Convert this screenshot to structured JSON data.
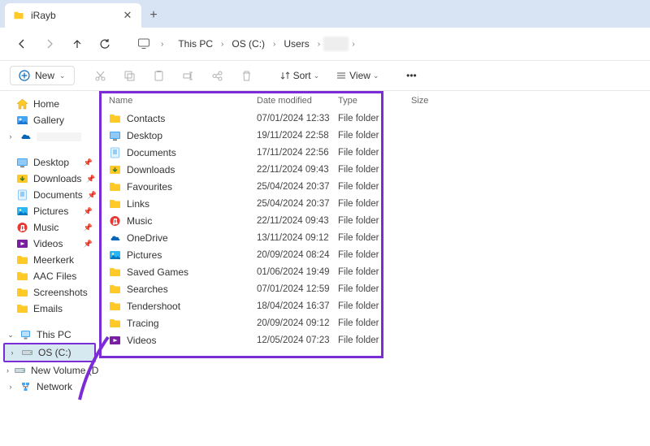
{
  "tab": {
    "title": "iRayb"
  },
  "breadcrumb": [
    "This PC",
    "OS (C:)",
    "Users"
  ],
  "toolbar": {
    "new_label": "New",
    "sort_label": "Sort",
    "view_label": "View"
  },
  "columns": {
    "name": "Name",
    "date": "Date modified",
    "type": "Type",
    "size": "Size"
  },
  "sidebar": {
    "quick": [
      {
        "label": "Home",
        "icon": "home"
      },
      {
        "label": "Gallery",
        "icon": "gallery"
      }
    ],
    "cloud_label": "",
    "pinned": [
      {
        "label": "Desktop",
        "icon": "desktop"
      },
      {
        "label": "Downloads",
        "icon": "downloads"
      },
      {
        "label": "Documents",
        "icon": "documents"
      },
      {
        "label": "Pictures",
        "icon": "pictures"
      },
      {
        "label": "Music",
        "icon": "music"
      },
      {
        "label": "Videos",
        "icon": "videos"
      },
      {
        "label": "Meerkerk",
        "icon": "folder"
      },
      {
        "label": "AAC Files",
        "icon": "folder"
      },
      {
        "label": "Screenshots",
        "icon": "folder"
      },
      {
        "label": "Emails",
        "icon": "folder"
      }
    ],
    "thispc": "This PC",
    "drives": [
      {
        "label": "OS (C:)",
        "selected": true
      },
      {
        "label": "New Volume (D:)",
        "selected": false
      }
    ],
    "network": "Network"
  },
  "files": [
    {
      "name": "Contacts",
      "date": "07/01/2024 12:33",
      "type": "File folder",
      "icon": "folder"
    },
    {
      "name": "Desktop",
      "date": "19/11/2024 22:58",
      "type": "File folder",
      "icon": "desktop"
    },
    {
      "name": "Documents",
      "date": "17/11/2024 22:56",
      "type": "File folder",
      "icon": "documents"
    },
    {
      "name": "Downloads",
      "date": "22/11/2024 09:43",
      "type": "File folder",
      "icon": "downloads"
    },
    {
      "name": "Favourites",
      "date": "25/04/2024 20:37",
      "type": "File folder",
      "icon": "folder"
    },
    {
      "name": "Links",
      "date": "25/04/2024 20:37",
      "type": "File folder",
      "icon": "folder"
    },
    {
      "name": "Music",
      "date": "22/11/2024 09:43",
      "type": "File folder",
      "icon": "music"
    },
    {
      "name": "OneDrive",
      "date": "13/11/2024 09:12",
      "type": "File folder",
      "icon": "onedrive"
    },
    {
      "name": "Pictures",
      "date": "20/09/2024 08:24",
      "type": "File folder",
      "icon": "pictures"
    },
    {
      "name": "Saved Games",
      "date": "01/06/2024 19:49",
      "type": "File folder",
      "icon": "folder"
    },
    {
      "name": "Searches",
      "date": "07/01/2024 12:59",
      "type": "File folder",
      "icon": "folder"
    },
    {
      "name": "Tendershoot",
      "date": "18/04/2024 16:37",
      "type": "File folder",
      "icon": "folder"
    },
    {
      "name": "Tracing",
      "date": "20/09/2024 09:12",
      "type": "File folder",
      "icon": "folder"
    },
    {
      "name": "Videos",
      "date": "12/05/2024 07:23",
      "type": "File folder",
      "icon": "videos"
    }
  ]
}
